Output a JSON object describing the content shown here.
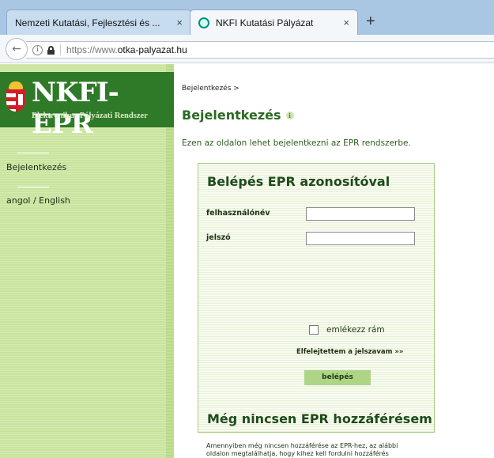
{
  "browser": {
    "tabs": [
      {
        "title": "Nemzeti Kutatási, Fejlesztési és ...",
        "close": "×"
      },
      {
        "title": "NKFI Kutatási Pályázat",
        "close": "×"
      }
    ],
    "new_tab": "+",
    "back": "←",
    "info": "i",
    "url_prefix": "https://www.",
    "url_host": "otka-palyazat.hu"
  },
  "logo": {
    "title": "NKFI-EPR",
    "subtitle": "Elektronikus Pályázati Rendszer"
  },
  "sidebar": {
    "items": [
      {
        "label": "Bejelentkezés"
      },
      {
        "label": "angol / English"
      }
    ]
  },
  "main": {
    "breadcrumb": "Bejelentkezés >",
    "title": "Bejelentkezés",
    "help": "i",
    "intro": "Ezen az oldalon lehet bejelentkezni az EPR rendszerbe.",
    "login": {
      "title": "Belépés EPR azonosítóval",
      "username_label": "felhasználónév",
      "username_value": "",
      "password_label": "jelszó",
      "password_value": "",
      "remember_label": "emlékezz rám",
      "forgot_label": "Elfelejtettem a jelszavam »»",
      "submit_label": "belépés"
    },
    "no_access": {
      "title": "Még nincsen EPR hozzáférésem",
      "text": "Amennyiben még nincsen hozzáférése az EPR-hez, az alábbi oldalon megtalálhatja, hogy kihez kell fordulni hozzáférés igényléséhez. »»"
    }
  },
  "colors": {
    "header_green": "#2f7a28",
    "title_green": "#2a6a22",
    "sidebar_green": "#c8e39e",
    "button_green": "#aed586"
  }
}
